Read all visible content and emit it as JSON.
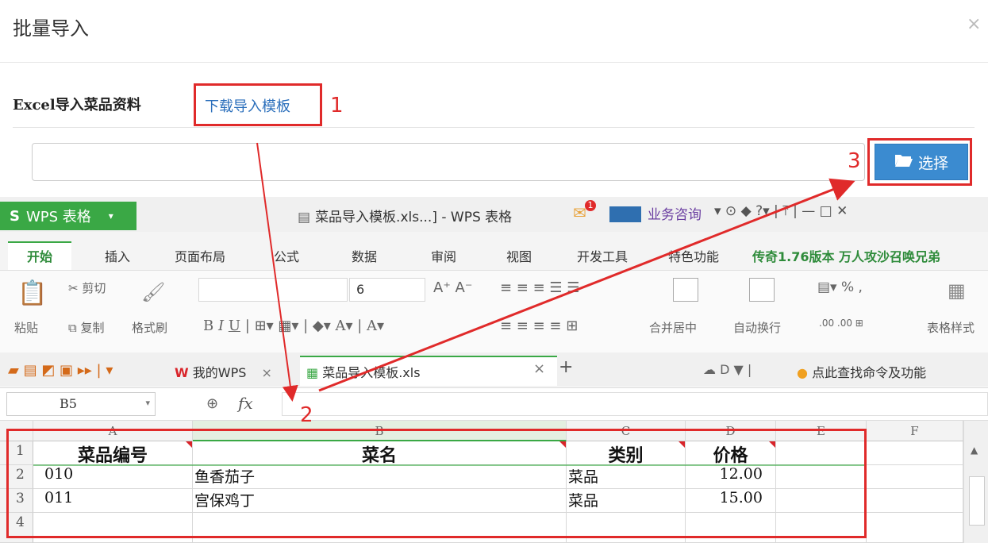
{
  "dialog": {
    "title": "批量导入",
    "close": "×",
    "import_label": "Excel导入菜品资料",
    "template_link": "下载导入模板",
    "choose_label": "选择",
    "annotations": [
      "1",
      "2",
      "3"
    ]
  },
  "wps": {
    "app_button": "WPS 表格",
    "window_title": "菜品导入模板.xls...] - WPS 表格",
    "mail_badge": "1",
    "consult": "业务咨询",
    "menu": [
      "开始",
      "插入",
      "页面布局",
      "公式",
      "数据",
      "审阅",
      "视图",
      "开发工具",
      "特色功能"
    ],
    "promo": "传奇1.76版本 万人攻沙召唤兄弟",
    "ribbon": {
      "paste": "粘贴",
      "cut": "剪切",
      "copy": "复制",
      "format_painter": "格式刷",
      "font_size": "6",
      "merge_center": "合并居中",
      "auto_wrap": "自动换行",
      "table_style": "表格样式"
    },
    "tabs": {
      "my_wps": "我的WPS",
      "file_tab": "菜品导入模板.xls",
      "find_command": "点此查找命令及功能"
    },
    "namebox": "B5",
    "fx": "fx",
    "columns": [
      "A",
      "B",
      "C",
      "D",
      "E",
      "F"
    ],
    "rows": [
      "1",
      "2",
      "3",
      "4"
    ],
    "table": {
      "headers": [
        "菜品编号",
        "菜名",
        "类别",
        "价格"
      ],
      "data": [
        [
          "010",
          "鱼香茄子",
          "菜品",
          "12.00"
        ],
        [
          "011",
          "宫保鸡丁",
          "菜品",
          "15.00"
        ]
      ]
    }
  },
  "colors": {
    "accent_blue": "#3b8bd0",
    "wps_green": "#3aa845",
    "annotation_red": "#e02a2a",
    "link_blue": "#2a6ebb"
  }
}
